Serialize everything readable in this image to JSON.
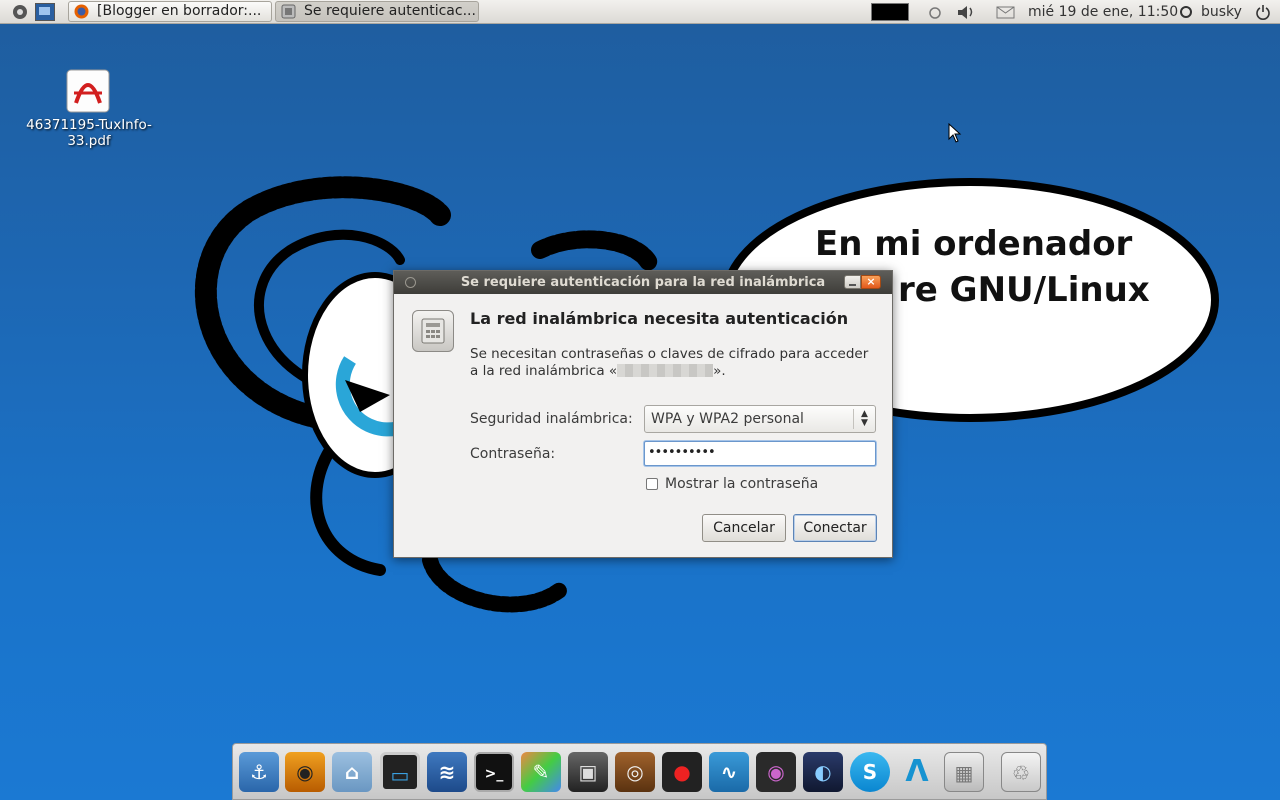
{
  "panel": {
    "tasks": [
      {
        "label": "[Blogger en borrador:...",
        "icon": "firefox-icon"
      },
      {
        "label": "Se requiere autenticac...",
        "icon": "network-auth-icon"
      }
    ],
    "clock": "mié 19 de ene, 11:50",
    "user": "busky"
  },
  "desktop": {
    "file_label": "46371195-TuxInfo-33.pdf",
    "wallpaper_text_line1": "En mi ordenador",
    "wallpaper_text_line2": "re GNU/Linux"
  },
  "dialog": {
    "title": "Se requiere autenticación para la red inalámbrica",
    "heading": "La red inalámbrica necesita autenticación",
    "description_before": "Se necesitan contraseñas o claves de cifrado para acceder a la red inalámbrica «",
    "description_after": "».",
    "security_label": "Seguridad inalámbrica:",
    "security_value": "WPA y WPA2 personal",
    "password_label": "Contraseña:",
    "password_value": "••••••••••",
    "show_password_label": "Mostrar la contraseña",
    "cancel_label": "Cancelar",
    "connect_label": "Conectar"
  },
  "dock": {
    "items": [
      "anchor-icon",
      "eye-icon",
      "home-folder-icon",
      "monitor-icon",
      "openoffice-icon",
      "terminal-icon",
      "paint-icon",
      "video-icon",
      "audio-icon",
      "record-icon",
      "system-monitor-icon",
      "camera-icon",
      "earth-icon",
      "skype-icon",
      "archlinux-icon",
      "network-settings-icon",
      "trash-icon"
    ]
  },
  "colors": {
    "desktop": "#1b6fc2",
    "title_bar": "#3e3d39",
    "close_button": "#e2581b"
  }
}
